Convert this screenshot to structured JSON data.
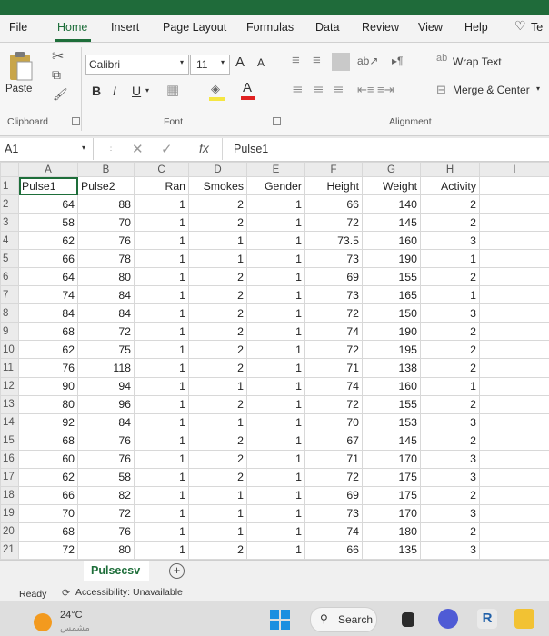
{
  "ribbon_tabs": [
    "File",
    "Home",
    "Insert",
    "Page Layout",
    "Formulas",
    "Data",
    "Review",
    "View",
    "Help",
    "Te"
  ],
  "clipboard": {
    "paste_label": "Paste",
    "group_label": "Clipboard"
  },
  "font": {
    "name": "Calibri",
    "size": "11",
    "bold": "B",
    "italic": "I",
    "underline": "U",
    "grow": "A",
    "shrink": "A",
    "color_letter": "A",
    "group_label": "Font",
    "fill_color": "#f5e642",
    "font_color": "#e02020"
  },
  "alignment": {
    "wrap_text": "Wrap Text",
    "merge_center": "Merge & Center",
    "group_label": "Alignment"
  },
  "formula_bar": {
    "name_box": "A1",
    "cancel": "✕",
    "enter": "✓",
    "fx": "fx",
    "content": "Pulse1"
  },
  "columns": [
    "A",
    "B",
    "C",
    "D",
    "E",
    "F",
    "G",
    "H",
    "I"
  ],
  "headers": [
    "Pulse1",
    "Pulse2",
    "Ran",
    "Smokes",
    "Gender",
    "Height",
    "Weight",
    "Activity"
  ],
  "rows": [
    [
      "64",
      "88",
      "1",
      "2",
      "1",
      "66",
      "140",
      "2"
    ],
    [
      "58",
      "70",
      "1",
      "2",
      "1",
      "72",
      "145",
      "2"
    ],
    [
      "62",
      "76",
      "1",
      "1",
      "1",
      "73.5",
      "160",
      "3"
    ],
    [
      "66",
      "78",
      "1",
      "1",
      "1",
      "73",
      "190",
      "1"
    ],
    [
      "64",
      "80",
      "1",
      "2",
      "1",
      "69",
      "155",
      "2"
    ],
    [
      "74",
      "84",
      "1",
      "2",
      "1",
      "73",
      "165",
      "1"
    ],
    [
      "84",
      "84",
      "1",
      "2",
      "1",
      "72",
      "150",
      "3"
    ],
    [
      "68",
      "72",
      "1",
      "2",
      "1",
      "74",
      "190",
      "2"
    ],
    [
      "62",
      "75",
      "1",
      "2",
      "1",
      "72",
      "195",
      "2"
    ],
    [
      "76",
      "118",
      "1",
      "2",
      "1",
      "71",
      "138",
      "2"
    ],
    [
      "90",
      "94",
      "1",
      "1",
      "1",
      "74",
      "160",
      "1"
    ],
    [
      "80",
      "96",
      "1",
      "2",
      "1",
      "72",
      "155",
      "2"
    ],
    [
      "92",
      "84",
      "1",
      "1",
      "1",
      "70",
      "153",
      "3"
    ],
    [
      "68",
      "76",
      "1",
      "2",
      "1",
      "67",
      "145",
      "2"
    ],
    [
      "60",
      "76",
      "1",
      "2",
      "1",
      "71",
      "170",
      "3"
    ],
    [
      "62",
      "58",
      "1",
      "2",
      "1",
      "72",
      "175",
      "3"
    ],
    [
      "66",
      "82",
      "1",
      "1",
      "1",
      "69",
      "175",
      "2"
    ],
    [
      "70",
      "72",
      "1",
      "1",
      "1",
      "73",
      "170",
      "3"
    ],
    [
      "68",
      "76",
      "1",
      "1",
      "1",
      "74",
      "180",
      "2"
    ],
    [
      "72",
      "80",
      "1",
      "2",
      "1",
      "66",
      "135",
      "3"
    ]
  ],
  "sheet_tab": "Pulsecsv",
  "add_sheet": "+",
  "status": {
    "ready": "Ready",
    "accessibility": "Accessibility: Unavailable"
  },
  "taskbar": {
    "weather_temp": "24°C",
    "weather_sub": "مشمس",
    "search": "Search"
  },
  "accent": "#1e6e3a"
}
